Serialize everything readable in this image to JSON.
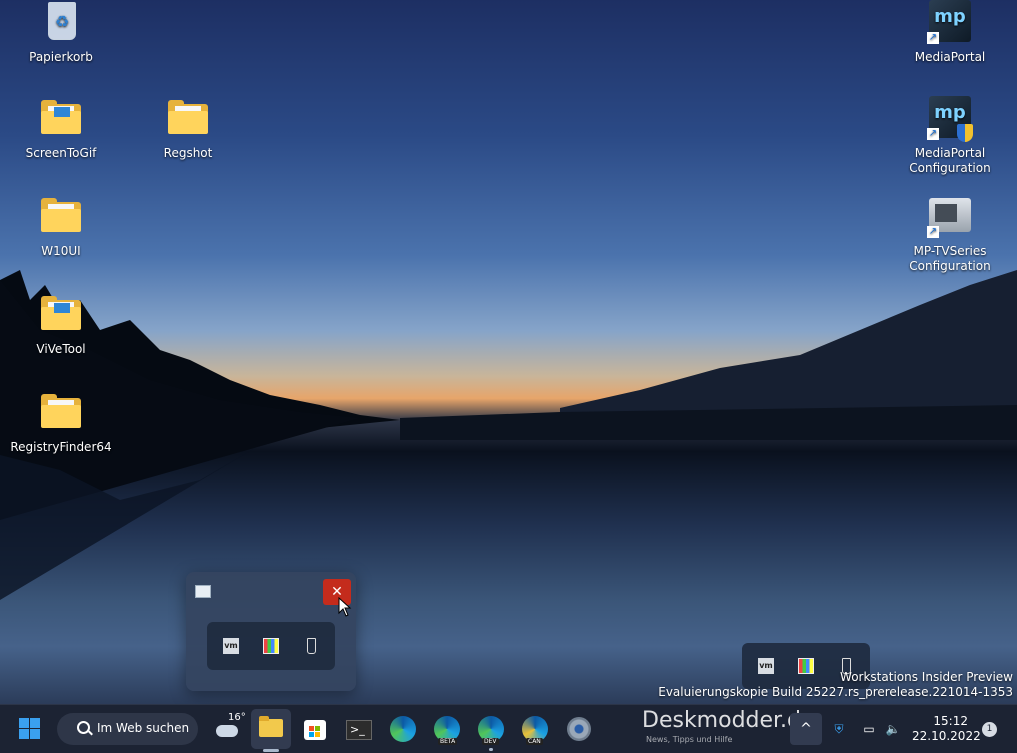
{
  "desktop": {
    "icons_left": [
      {
        "label": "Papierkorb",
        "icon": "recycle-bin-icon"
      },
      {
        "label": "ScreenToGif",
        "icon": "folder-icon"
      },
      {
        "label": "Regshot",
        "icon": "folder-icon"
      },
      {
        "label": "W10UI",
        "icon": "folder-icon"
      },
      {
        "label": "ViVeTool",
        "icon": "folder-icon"
      },
      {
        "label": "RegistryFinder64",
        "icon": "folder-icon"
      }
    ],
    "icons_right": [
      {
        "label": "MediaPortal",
        "icon": "mediaportal-icon"
      },
      {
        "label": "MediaPortal Configuration",
        "icon": "mediaportal-config-icon"
      },
      {
        "label": "MP-TVSeries Configuration",
        "icon": "tvseries-icon"
      }
    ]
  },
  "overflow_popup": {
    "close_glyph": "✕",
    "tray_icons": [
      "vmware-icon",
      "color-palette-icon",
      "usb-drive-icon"
    ]
  },
  "mini_tray": {
    "tray_icons": [
      "vmware-icon",
      "color-palette-icon",
      "usb-drive-icon"
    ]
  },
  "watermark": {
    "line1": "Workstations Insider Preview",
    "line2": "Evaluierungskopie Build 25227.rs_prerelease.221014-1353"
  },
  "taskbar": {
    "search_label": "Im Web suchen",
    "weather_temp": "16°",
    "apps": [
      "file-explorer-icon",
      "microsoft-store-icon",
      "terminal-icon",
      "edge-icon",
      "edge-beta-icon",
      "edge-dev-icon",
      "edge-canary-icon",
      "settings-icon"
    ],
    "edge_badges": {
      "beta": "BETA",
      "dev": "DEV",
      "can": "CAN"
    },
    "overlay_brand": "Deskmodder.de",
    "overlay_sub": "News, Tipps und Hilfe",
    "chevron": "^",
    "time": "15:12",
    "date": "22.10.2022",
    "notification_count": "1"
  },
  "colors": {
    "taskbar_bg": "#1c2333",
    "close_red": "#c42b1c",
    "accent_blue": "#3aa0ef"
  }
}
